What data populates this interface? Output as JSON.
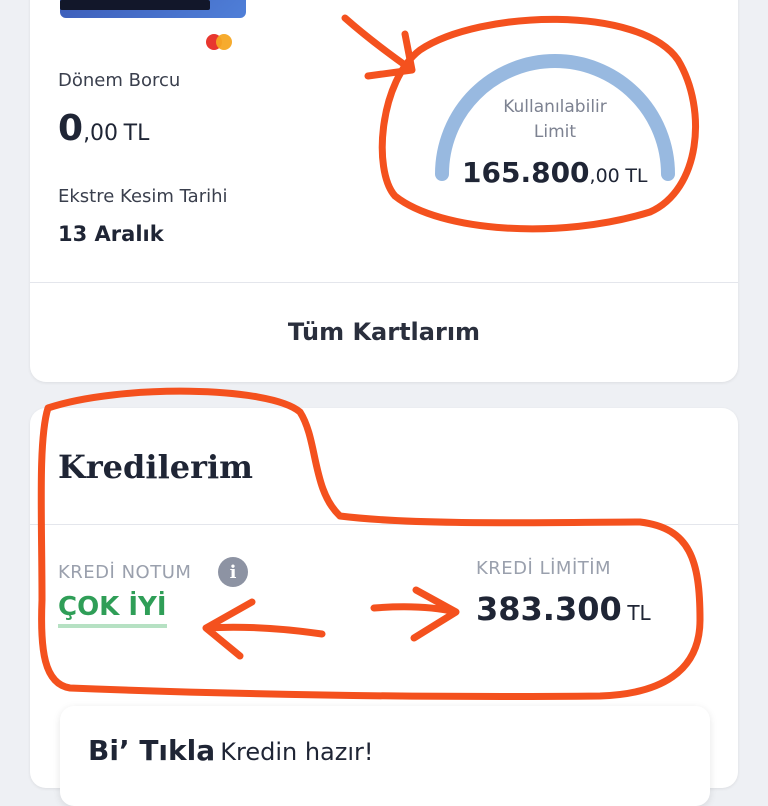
{
  "cards_section": {
    "period_debt_label": "Dönem Borcu",
    "period_debt_int": "0",
    "period_debt_dec": ",00",
    "period_debt_unit": "TL",
    "statement_date_label": "Ekstre Kesim Tarihi",
    "statement_date_value": "13 Aralık",
    "available_limit_label_line1": "Kullanılabilir",
    "available_limit_label_line2": "Limit",
    "available_limit_int": "165.800",
    "available_limit_dec": ",00",
    "available_limit_unit": "TL",
    "all_cards_button": "Tüm Kartlarım"
  },
  "credits_section": {
    "title": "Kredilerim",
    "credit_score_label": "KREDİ NOTUM",
    "credit_score_value": "ÇOK İYİ",
    "info_icon_glyph": "i",
    "credit_limit_label": "KREDİ LİMİTİM",
    "credit_limit_value": "383.300",
    "credit_limit_unit": "TL"
  },
  "promo": {
    "brand": "Bi’ Tıkla",
    "text": "Kredin hazır!"
  },
  "colors": {
    "gauge": "#98b9e0",
    "annotation": "#f4511e",
    "score_green": "#2f9e57"
  },
  "icons": [
    "info-icon",
    "annotation-arrow-icon"
  ]
}
